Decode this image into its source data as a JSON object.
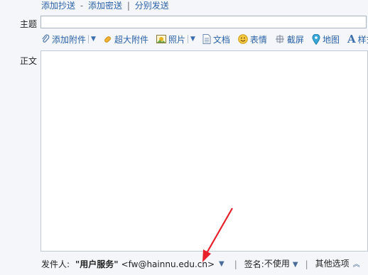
{
  "recipients": {
    "add_cc": "添加抄送",
    "dash": "-",
    "add_bcc": "添加密送",
    "bar": "|",
    "separate_send": "分别发送"
  },
  "subject": {
    "label": "主题",
    "value": ""
  },
  "toolbar": {
    "attachment": "添加附件",
    "large_attachment": "超大附件",
    "photo": "照片",
    "document": "文档",
    "emoticon": "表情",
    "screenshot": "截屏",
    "map": "地图",
    "style": "样式"
  },
  "body": {
    "label": "正文",
    "value": ""
  },
  "footer": {
    "sender_label": "发件人:",
    "sender_name": "\"用户服务\"",
    "sender_email": "<fw@hainnu.edu.cn>",
    "signature_label": "签名:",
    "signature_value": "不使用",
    "other_options": "其他选项"
  },
  "icons": {
    "paperclip": "paperclip-icon",
    "large-attachment": "large-attachment-icon",
    "photo": "photo-icon",
    "document": "document-icon",
    "emoticon": "smiley-icon",
    "screenshot": "scissors-icon",
    "map": "map-pin-icon",
    "style": "font-style-icon"
  },
  "colors": {
    "link": "#2a62a8",
    "annotation_arrow": "#e8202a"
  }
}
